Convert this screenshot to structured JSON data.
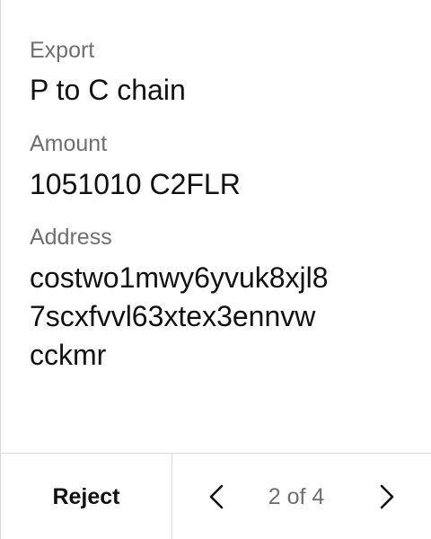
{
  "fields": {
    "export": {
      "label": "Export",
      "value": "P to C chain"
    },
    "amount": {
      "label": "Amount",
      "value": "1051010 C2FLR"
    },
    "address": {
      "label": "Address",
      "lines": [
        "costwo1mwy6yvuk8xjl8",
        "7scxfvvl63xtex3ennvw",
        "cckmr"
      ]
    }
  },
  "footer": {
    "reject_label": "Reject",
    "page_indicator": "2 of 4",
    "prev_icon": "chevron-left-icon",
    "next_icon": "chevron-right-icon"
  }
}
